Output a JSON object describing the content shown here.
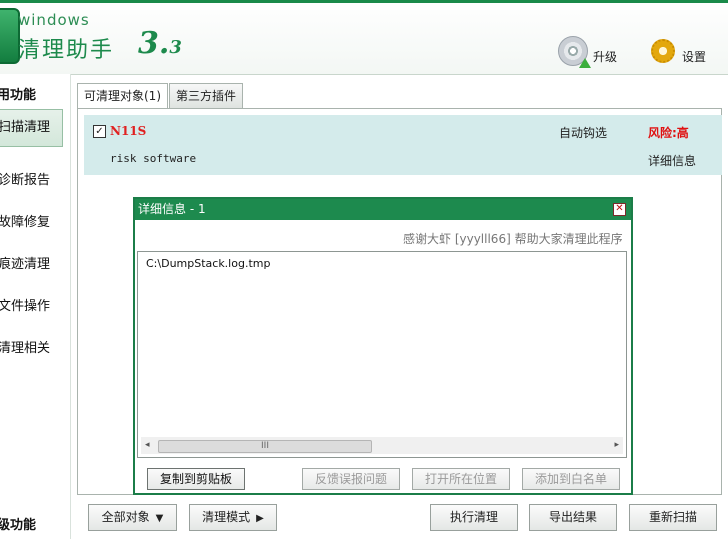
{
  "app": {
    "logo_small": "windows",
    "logo_name": "清理助手",
    "version_main": "3.",
    "version_sub": "3"
  },
  "header_buttons": {
    "upgrade_label": "升级",
    "upgrade_icon": "cd-upgrade-icon",
    "settings_label": "设置",
    "settings_icon": "gear-icon"
  },
  "sidebar": {
    "section_title": "用功能",
    "items": [
      {
        "label": "扫描清理",
        "active": true
      },
      {
        "label": "诊断报告"
      },
      {
        "label": "故障修复"
      },
      {
        "label": "痕迹清理"
      },
      {
        "label": "文件操作"
      },
      {
        "label": "清理相关"
      }
    ],
    "footer_title": "级功能"
  },
  "tabs": [
    {
      "label": "可清理对象(1)",
      "active": true
    },
    {
      "label": "第三方插件"
    }
  ],
  "result": {
    "checked": true,
    "name": "N11S",
    "description": "risk software",
    "auto_select": "自动钩选",
    "risk": "风险:高",
    "detail_link": "详细信息"
  },
  "dialog": {
    "title": "详细信息 - 1",
    "close_glyph": "✕",
    "thanks": "感谢大虾 [yyylll66] 帮助大家清理此程序",
    "path": "C:\\DumpStack.log.tmp",
    "scroll_left": "◂",
    "scroll_right": "▸",
    "scroll_grip": "III",
    "buttons": {
      "copy": "复制到剪贴板",
      "report": "反馈误报问题",
      "open_location": "打开所在位置",
      "whitelist": "添加到白名单"
    }
  },
  "bottom": {
    "all_objects": "全部对象",
    "clean_mode": "清理模式",
    "execute": "执行清理",
    "export": "导出结果",
    "rescan": "重新扫描",
    "dropdown_glyph": "▼",
    "submenu_glyph": "▶"
  },
  "colors": {
    "brand_green": "#1d8a4e",
    "risk_red": "#e01010",
    "result_bg": "#d4ebeb"
  }
}
